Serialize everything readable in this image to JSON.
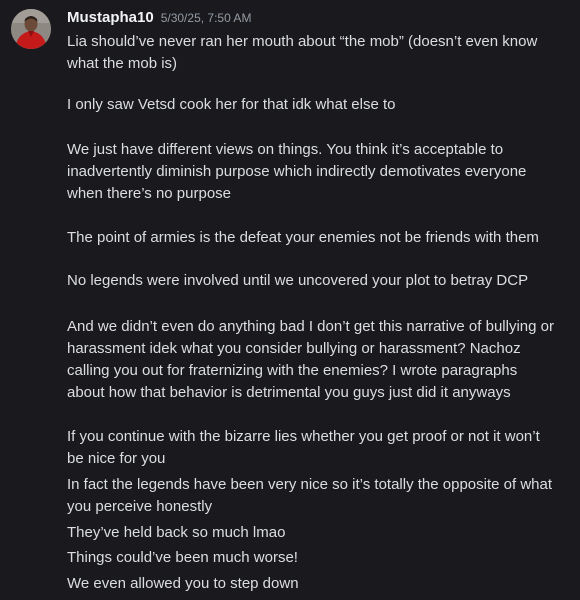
{
  "message": {
    "author": "Mustapha10",
    "timestamp": "5/30/25, 7:50 AM",
    "avatar_icon": "user-avatar-icon",
    "lines": [
      "Lia should’ve never ran her mouth about “the mob” (doesn’t even know",
      "what the mob is)",
      "I only saw Vetsd cook her for that idk what else to",
      "We just have different views on things. You think it’s acceptable to",
      "inadvertently diminish purpose which indirectly demotivates everyone",
      "when there’s no purpose",
      "The point of armies is the defeat your enemies not be friends with them",
      "No legends were involved until we uncovered your plot to betray DCP",
      "And we didn’t even do anything bad I don’t get this narrative of bullying or",
      "harassment idek what you consider bullying or harassment? Nachoz",
      "calling you out for fraternizing with the enemies? I wrote paragraphs",
      "about how that behavior is detrimental you guys just did it anyways",
      "If you continue with the bizarre lies whether you get proof or not it won’t",
      "be nice for you",
      "In fact the legends have been very nice so it’s totally the opposite of what",
      "you perceive honestly",
      "They’ve held back so much lmao",
      "Things could’ve been much worse!",
      "We even allowed you to step down"
    ]
  },
  "colors": {
    "background": "#1a1a1e",
    "author": "#f2f3f5",
    "timestamp": "#949ba4",
    "text": "#dbdee1",
    "avatar_shirt": "#c41a1a"
  }
}
